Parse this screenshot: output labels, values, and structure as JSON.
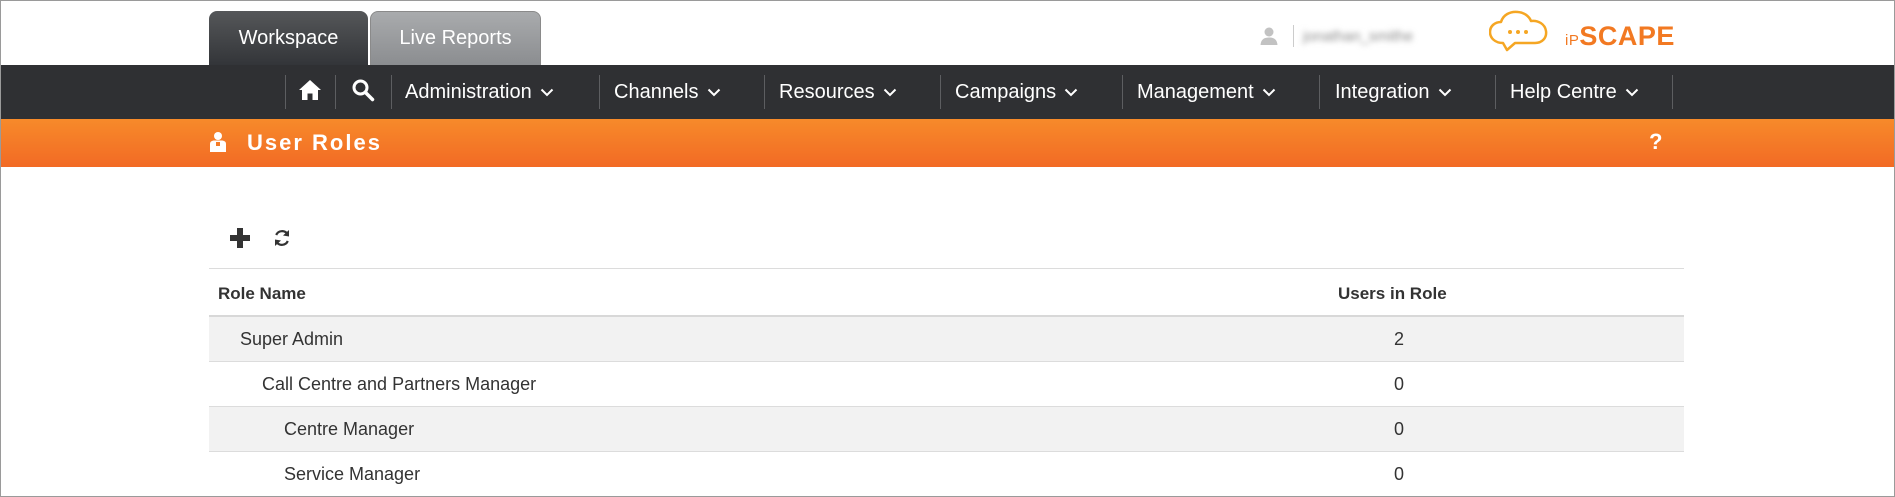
{
  "tabs": {
    "workspace": "Workspace",
    "live_reports": "Live Reports"
  },
  "user": {
    "name": "jonathan_smithe"
  },
  "brand": {
    "logo_prefix": "iP",
    "logo_text": "SCAPE",
    "color": "#f27922"
  },
  "nav": {
    "home_icon": "home-icon",
    "search_icon": "search-icon",
    "items": [
      {
        "label": "Administration"
      },
      {
        "label": "Channels"
      },
      {
        "label": "Resources"
      },
      {
        "label": "Campaigns"
      },
      {
        "label": "Management"
      },
      {
        "label": "Integration"
      },
      {
        "label": "Help Centre"
      }
    ]
  },
  "page": {
    "title": "User Roles",
    "help_label": "?",
    "header_color": "#f47b27"
  },
  "toolbar": {
    "add_icon": "plus-icon",
    "refresh_icon": "refresh-icon"
  },
  "table": {
    "headers": {
      "role_name": "Role Name",
      "users_in_role": "Users in Role"
    },
    "rows": [
      {
        "name": "Super Admin",
        "users": "2",
        "level": 1
      },
      {
        "name": "Call Centre and Partners Manager",
        "users": "0",
        "level": 2
      },
      {
        "name": "Centre Manager",
        "users": "0",
        "level": 3
      },
      {
        "name": "Service Manager",
        "users": "0",
        "level": 3
      }
    ]
  }
}
